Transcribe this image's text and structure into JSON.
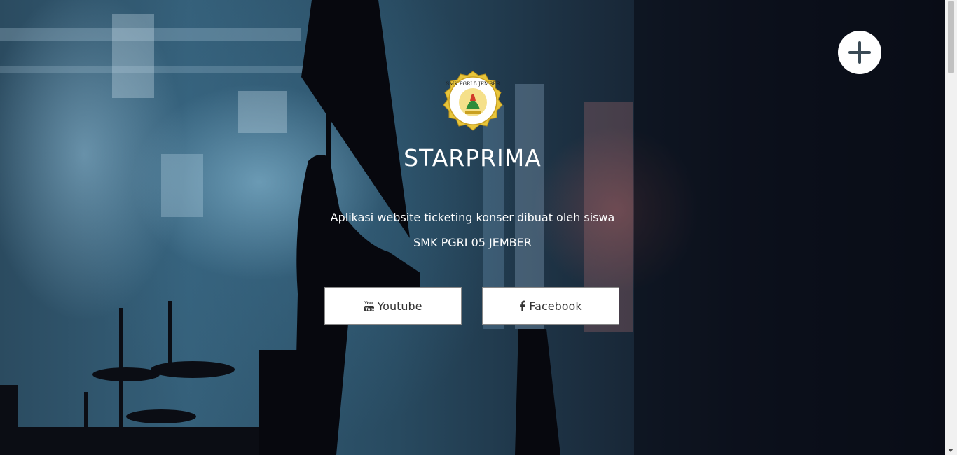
{
  "hero": {
    "logo_text": "SMK PGRI 5 JEMBER",
    "title": "STARPRIMA",
    "description_line1": "Aplikasi website ticketing konser dibuat oleh siswa",
    "description_line2": "SMK PGRI 05 JEMBER"
  },
  "buttons": {
    "youtube_label": "Youtube",
    "youtube_icon": "youtube-icon",
    "facebook_label": "Facebook",
    "facebook_icon": "facebook-icon"
  },
  "menu_button": {
    "icon": "plus-icon"
  },
  "colors": {
    "accent_logo_gold": "#e8c53a",
    "button_text": "#333333",
    "background_dark": "#0a0a14"
  }
}
